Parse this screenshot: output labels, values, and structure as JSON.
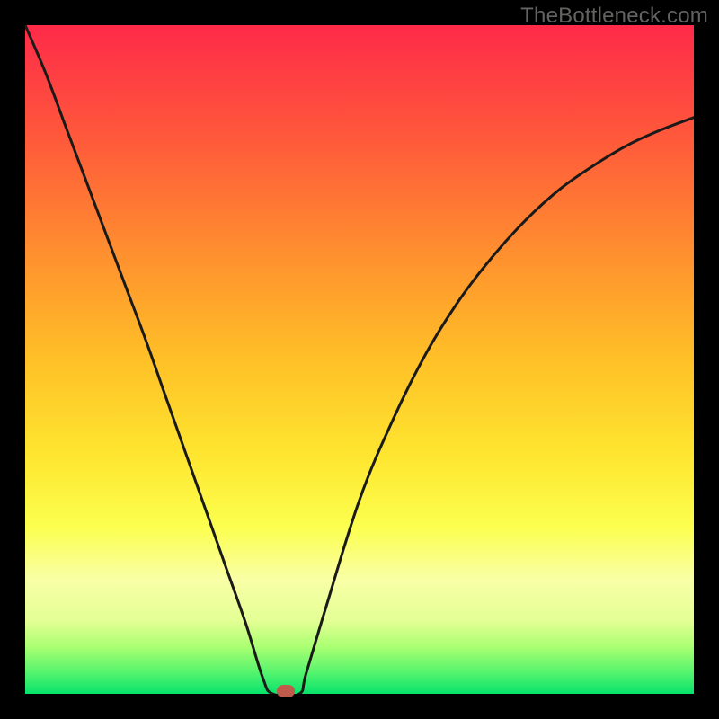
{
  "watermark": "TheBottleneck.com",
  "chart_data": {
    "type": "line",
    "title": "",
    "xlabel": "",
    "ylabel": "",
    "xlim": [
      0,
      1
    ],
    "ylim": [
      0,
      1
    ],
    "legend": false,
    "grid": false,
    "marker": {
      "x": 0.39,
      "y": 0.0
    },
    "series": [
      {
        "name": "curve",
        "x": [
          0.0,
          0.03,
          0.06,
          0.09,
          0.12,
          0.15,
          0.18,
          0.21,
          0.24,
          0.27,
          0.3,
          0.33,
          0.355,
          0.37,
          0.41,
          0.42,
          0.45,
          0.5,
          0.55,
          0.6,
          0.65,
          0.7,
          0.75,
          0.8,
          0.85,
          0.9,
          0.95,
          1.0
        ],
        "y": [
          1.0,
          0.93,
          0.85,
          0.77,
          0.69,
          0.61,
          0.53,
          0.445,
          0.36,
          0.275,
          0.19,
          0.105,
          0.025,
          0.0,
          0.0,
          0.03,
          0.13,
          0.29,
          0.41,
          0.51,
          0.59,
          0.655,
          0.71,
          0.755,
          0.79,
          0.82,
          0.843,
          0.862
        ]
      }
    ],
    "background_gradient_to_bottom": [
      {
        "pos": 0.0,
        "color": "#fe2a49"
      },
      {
        "pos": 0.18,
        "color": "#ff5c3a"
      },
      {
        "pos": 0.34,
        "color": "#ff8f2f"
      },
      {
        "pos": 0.5,
        "color": "#ffc027"
      },
      {
        "pos": 0.64,
        "color": "#fee52f"
      },
      {
        "pos": 0.75,
        "color": "#fcff4e"
      },
      {
        "pos": 0.83,
        "color": "#f8ffa6"
      },
      {
        "pos": 0.89,
        "color": "#e4ff95"
      },
      {
        "pos": 0.93,
        "color": "#aaff71"
      },
      {
        "pos": 0.965,
        "color": "#5cf56e"
      },
      {
        "pos": 1.0,
        "color": "#07e36b"
      }
    ]
  }
}
